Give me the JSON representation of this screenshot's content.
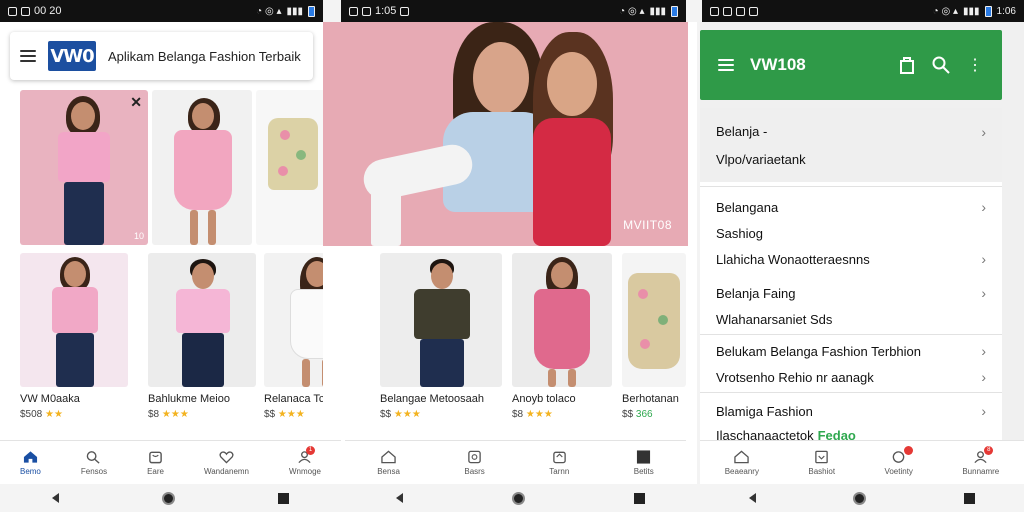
{
  "panel1": {
    "status": {
      "time": "00 20"
    },
    "appbar": {
      "logo": "VW0",
      "title": "Aplikam Belanga Fashion Terbaik"
    },
    "tile_corner": "10",
    "products": [
      {
        "name": "VW M0aaka",
        "price": "$508",
        "stars": "★★"
      },
      {
        "name": "Bahlukme Meioo",
        "price": "$8",
        "stars": "★★★"
      },
      {
        "name": "Relanaca Tcelci",
        "price": "$$",
        "stars": "★★★"
      }
    ],
    "nav": [
      {
        "label": "Bemo",
        "icon": "home-icon"
      },
      {
        "label": "Fensos",
        "icon": "search-icon"
      },
      {
        "label": "Eare",
        "icon": "bag-icon"
      },
      {
        "label": "Wandanemn",
        "icon": "heart-icon"
      },
      {
        "label": "Wnmoge",
        "icon": "user-icon",
        "badge": "1"
      }
    ]
  },
  "panel2": {
    "status": {
      "time": "1:05"
    },
    "hero_watermark": "MVIIT08",
    "products": [
      {
        "name": "Belangae Metoosaah",
        "price": "$$",
        "stars": "★★★"
      },
      {
        "name": "Anoyb tolaco",
        "price": "$8",
        "stars": "★★★"
      },
      {
        "name": "Berhotanan",
        "price": "$$",
        "stars": "366"
      }
    ],
    "nav": [
      {
        "label": "Bensa",
        "icon": "home-icon"
      },
      {
        "label": "Basrs",
        "icon": "search-icon"
      },
      {
        "label": "Tarnn",
        "icon": "bag-icon"
      },
      {
        "label": "Betits",
        "icon": "square-icon"
      }
    ]
  },
  "panel3": {
    "status": {
      "time": "1:06"
    },
    "appbar": {
      "title": "VW108"
    },
    "menu": [
      {
        "line1": "Belanja -",
        "line2": "Vlpo/variaetank"
      },
      {
        "line1": "Belangana",
        "line2": "Sashiog"
      },
      {
        "line1": "Llahicha Wonaotteraesnns",
        "line2": ""
      },
      {
        "line1": "Belanja Faing",
        "line2": "Wlahanarsaniet Sds"
      },
      {
        "line1": "Belukam Belanga Fashion Terbhion",
        "line2": "Vrotsenho Rehio nr aanagk"
      },
      {
        "line1": "Blamiga Fashion",
        "line2": "Ilaschanaactetok",
        "line2_extra": "Fedao"
      }
    ],
    "nav": [
      {
        "label": "Beaeanry",
        "icon": "home-icon"
      },
      {
        "label": "Bashiot",
        "icon": "bag-icon"
      },
      {
        "label": "Voetinty",
        "icon": "heart-icon",
        "badge": ""
      },
      {
        "label": "Bunnamre",
        "icon": "user-icon",
        "badge": "8"
      }
    ]
  },
  "colors": {
    "brand_blue": "#1c4fa0",
    "green": "#2f9a48",
    "star": "#f3b320"
  }
}
